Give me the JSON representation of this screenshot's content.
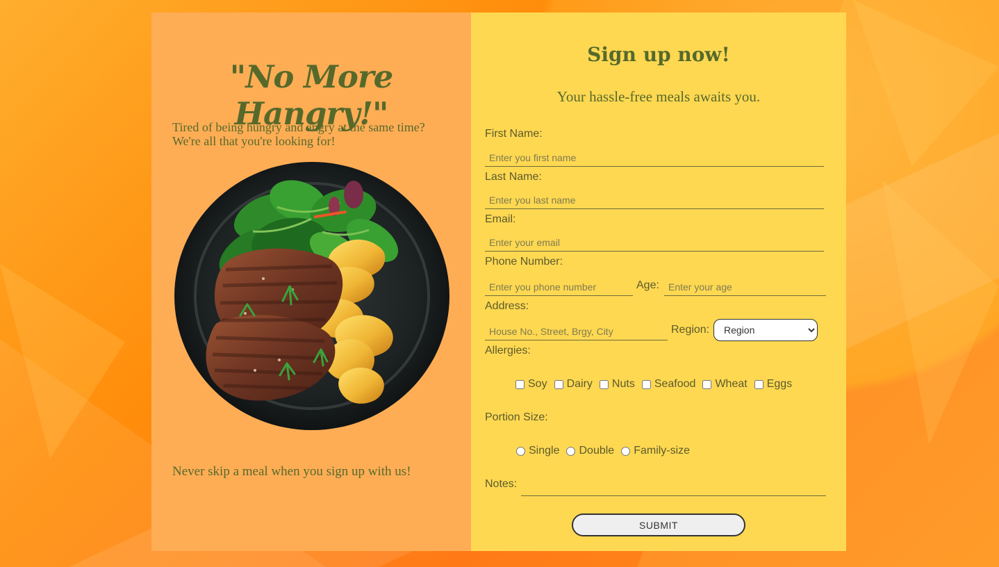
{
  "hero": {
    "title": "\"No More Hangry!\"",
    "intro": "Tired of being hungry and angry at the same time? We're all that you're looking for!",
    "tagline": "Never skip a meal when you sign up with us!"
  },
  "form": {
    "title": "Sign up now!",
    "subtitle": "Your hassle-free meals awaits you.",
    "first_name": {
      "label": "First Name:",
      "placeholder": "Enter you first name"
    },
    "last_name": {
      "label": "Last Name:",
      "placeholder": "Enter you last name"
    },
    "email": {
      "label": "Email:",
      "placeholder": "Enter your email"
    },
    "phone": {
      "label": "Phone Number:",
      "placeholder": "Enter you phone number"
    },
    "age": {
      "label": "Age:",
      "placeholder": "Enter your age"
    },
    "address": {
      "label": "Address:",
      "placeholder": "House No., Street, Brgy, City"
    },
    "region": {
      "label": "Region:",
      "selected": "Region"
    },
    "allergies": {
      "label": "Allergies:",
      "options": [
        "Soy",
        "Dairy",
        "Nuts",
        "Seafood",
        "Wheat",
        "Eggs"
      ]
    },
    "portion": {
      "label": "Portion Size:",
      "options": [
        "Single",
        "Double",
        "Family-size"
      ]
    },
    "notes": {
      "label": "Notes:"
    },
    "submit": "SUBMIT"
  },
  "icons": {
    "region_dropdown": "chevron-down-icon"
  },
  "colors": {
    "left_panel": "#ffad55",
    "right_panel": "#ffd852",
    "text": "#56692b"
  }
}
